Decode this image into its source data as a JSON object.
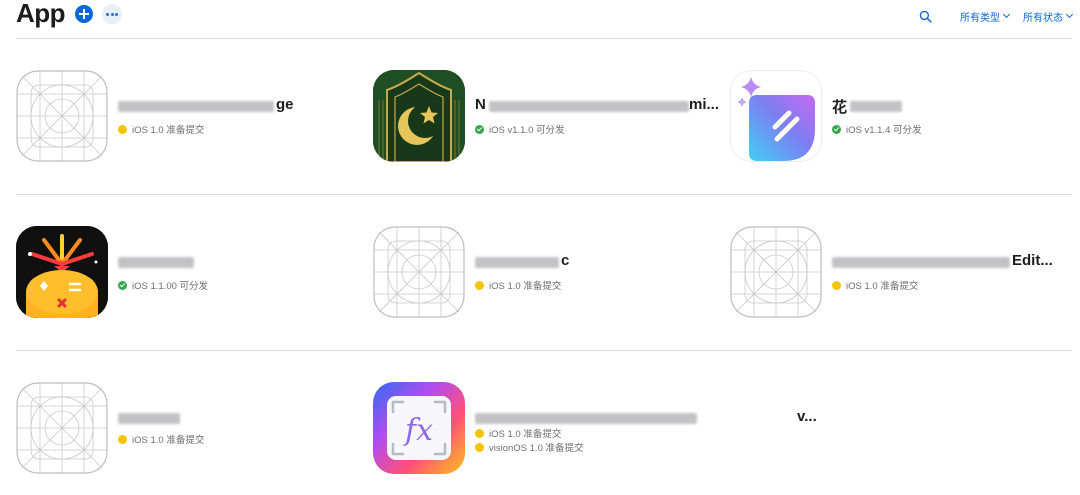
{
  "header": {
    "title": "App",
    "filter_type": "所有类型",
    "filter_status": "所有状态"
  },
  "apps": [
    {
      "name_visible_tail": "ge",
      "name_visible_head": "",
      "icon": "placeholder-grid-icon",
      "statuses": [
        {
          "text": "iOS 1.0 准备提交",
          "color": "yellow"
        }
      ]
    },
    {
      "name_visible_tail": "mi...",
      "name_visible_head": "N",
      "icon": "crescent-star-mosque-icon",
      "statuses": [
        {
          "text": "iOS v1.1.0 可分发",
          "color": "green"
        }
      ]
    },
    {
      "name_visible_tail": "",
      "name_visible_head": "花",
      "icon": "sparkle-leaf-app-icon",
      "statuses": [
        {
          "text": "iOS v1.1.4 可分发",
          "color": "green"
        }
      ]
    },
    {
      "name_visible_tail": "",
      "name_visible_head": "",
      "icon": "firework-face-app-icon",
      "statuses": [
        {
          "text": "iOS 1.1.00 可分发",
          "color": "green"
        }
      ]
    },
    {
      "name_visible_tail": "c",
      "name_visible_head": "",
      "icon": "placeholder-grid-icon",
      "statuses": [
        {
          "text": "iOS 1.0 准备提交",
          "color": "yellow"
        }
      ]
    },
    {
      "name_visible_tail": "Edit...",
      "name_visible_head": "",
      "icon": "placeholder-grid-icon",
      "statuses": [
        {
          "text": "iOS 1.0 准备提交",
          "color": "yellow"
        }
      ]
    },
    {
      "name_visible_tail": "",
      "name_visible_head": "",
      "icon": "placeholder-grid-icon",
      "statuses": [
        {
          "text": "iOS 1.0 准备提交",
          "color": "yellow"
        }
      ]
    },
    {
      "name_visible_tail": "v...",
      "name_visible_head": "",
      "icon": "fx-gradient-app-icon",
      "statuses": [
        {
          "text": "iOS 1.0 准备提交",
          "color": "yellow"
        },
        {
          "text": "visionOS 1.0 准备提交",
          "color": "yellow"
        }
      ]
    }
  ],
  "colors": {
    "accent": "#0b66d6",
    "status_ready": "#f5c400",
    "status_available": "#30a84a"
  }
}
